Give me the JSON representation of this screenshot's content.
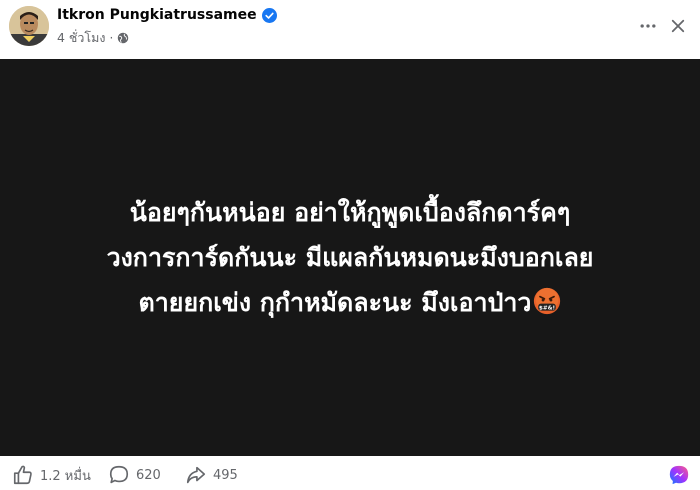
{
  "post": {
    "author": "Itkron Pungkiatrussamee",
    "time": "4 ชั่วโมง",
    "separator": "·",
    "lines": [
      "น้อยๆกันหน่อย อย่าให้กูพูดเบื้องลึกดาร์คๆ",
      "วงการการ์ดกันนะ มีแผลกันหมดนะมึงบอกเลย",
      "ตายยกเข่ง กุกำหมัดละนะ มึงเอาป่าว"
    ],
    "emoji": "angry-cursing-face",
    "emoji_text": "$#&!"
  },
  "actions": {
    "likes": "1.2 หมื่น",
    "comments": "620",
    "shares": "495"
  },
  "icons": {
    "verified": "verified-badge-icon",
    "globe": "globe-icon",
    "more": "more-icon",
    "close": "close-icon",
    "like": "thumbs-up-icon",
    "comment": "comment-bubble-icon",
    "share": "share-arrow-icon",
    "messenger": "messenger-icon"
  },
  "colors": {
    "verified_blue": "#1877f2",
    "post_background": "#171717",
    "muted_text": "#65676b"
  }
}
